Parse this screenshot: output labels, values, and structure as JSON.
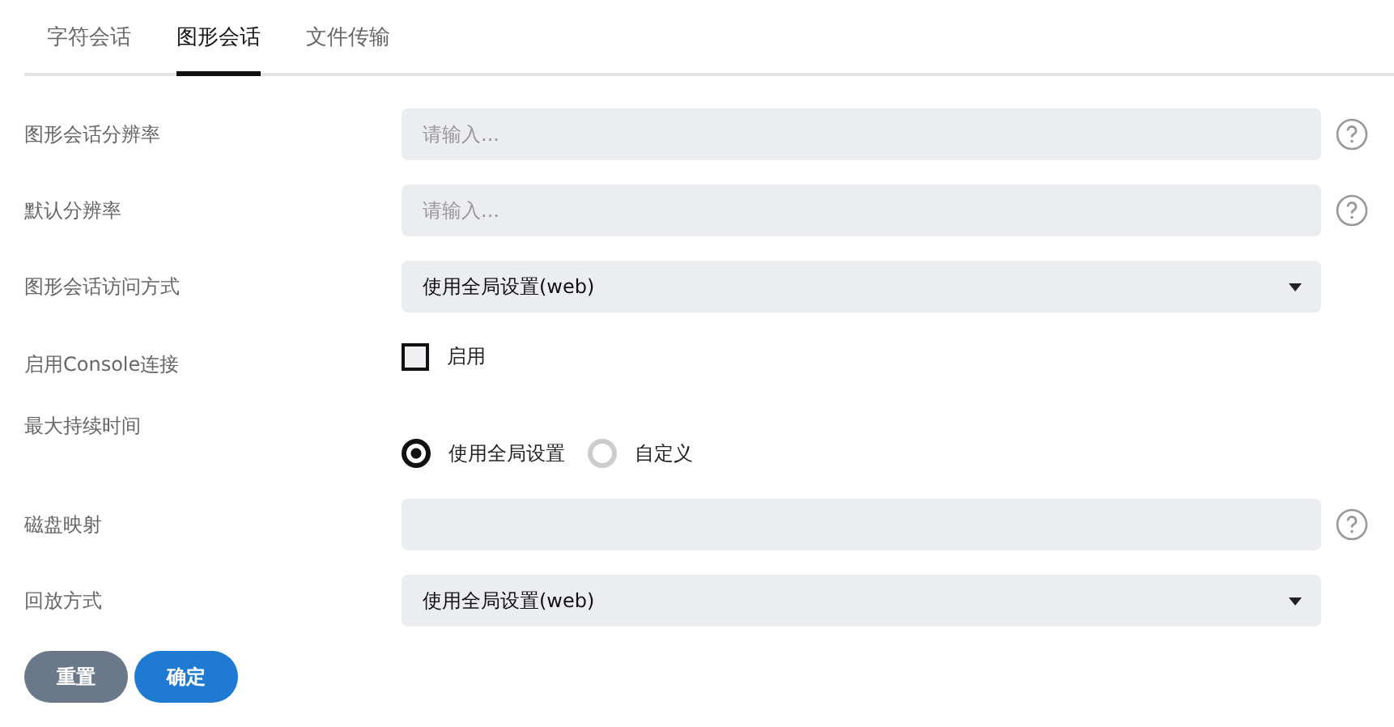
{
  "tabs": [
    {
      "label": "字符会话",
      "selected": false
    },
    {
      "label": "图形会话",
      "selected": true
    },
    {
      "label": "文件传输",
      "selected": false
    }
  ],
  "fields": [
    {
      "kind": "text",
      "label": "图形会话分辨率",
      "placeholder": "请输入...",
      "help": true
    },
    {
      "kind": "text",
      "label": "默认分辨率",
      "placeholder": "请输入...",
      "help": true
    },
    {
      "kind": "select",
      "label": "图形会话访问方式",
      "value": "使用全局设置(web)"
    },
    {
      "kind": "checkbox",
      "label": "启用Console连接",
      "option": "启用",
      "checked": false
    },
    {
      "kind": "radio",
      "label": "最大持续时间",
      "options": [
        {
          "label": "使用全局设置",
          "selected": true
        },
        {
          "label": "自定义",
          "selected": false
        }
      ]
    },
    {
      "kind": "text",
      "label": "磁盘映射",
      "help": true
    },
    {
      "kind": "select",
      "label": "回放方式",
      "value": "使用全局设置(web)"
    }
  ],
  "buttons": [
    {
      "label": "重置",
      "kind": "secondary"
    },
    {
      "label": "确定",
      "kind": "primary"
    }
  ]
}
